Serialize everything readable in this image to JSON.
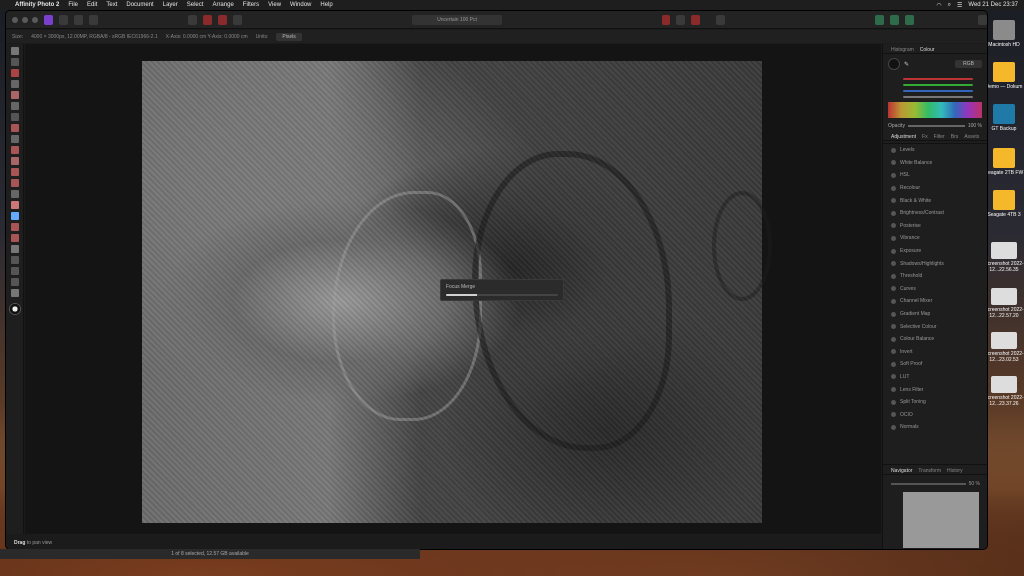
{
  "menubar": {
    "app_name": "Affinity Photo 2",
    "menus": [
      "File",
      "Edit",
      "Text",
      "Document",
      "Layer",
      "Select",
      "Arrange",
      "Filters",
      "View",
      "Window",
      "Help"
    ],
    "clock": "Wed 21 Dec  23:37"
  },
  "window": {
    "center_label": "Uncertain 100 Pct",
    "context_bar": {
      "label": "Size:",
      "items": [
        "4000 × 3000px, 12.00MP, RGBA/8 - sRGB IEC61966-2.1",
        "X-Axis: 0.0000 cm  Y-Axis: 0.0000 cm",
        "Units:"
      ],
      "units_value": "Pixels"
    },
    "status": {
      "label": "Drag",
      "hint": "to pan view"
    }
  },
  "dialog": {
    "title": "Focus Merge",
    "progress": 0.28
  },
  "panels": {
    "top_tabs": [
      "Histogram",
      "Colour"
    ],
    "active_tab": "Colour",
    "colour_mode": "RGB",
    "opacity_label": "Opacity",
    "opacity_value": "100 %",
    "adjust_tabs": [
      "Adjustment",
      "Fx",
      "Filter",
      "Brs",
      "Assets"
    ],
    "adjustments": [
      "Levels",
      "White Balance",
      "HSL",
      "Recolour",
      "Black & White",
      "Brightness/Contrast",
      "Posterise",
      "Vibrance",
      "Exposure",
      "Shadows/Highlights",
      "Threshold",
      "Curves",
      "Channel Mixer",
      "Gradient Map",
      "Selective Colour",
      "Colour Balance",
      "Invert",
      "Soft Proof",
      "LUT",
      "Lens Filter",
      "Split Toning",
      "OCIO",
      "Normals"
    ],
    "nav_tabs": [
      "Navigator",
      "Transform",
      "History"
    ],
    "nav_zoom": "50 %"
  },
  "desktop": {
    "icons": [
      "Macintosh HD",
      "Demo — Dokum",
      "GT Backup",
      "Seagate 2TB FW",
      "Seagate 4TB 3",
      "Screenshot 2022-12...22.56.35",
      "Screenshot 2022-12...22.57.20",
      "Screenshot 2022-12...23.02.53",
      "Screenshot 2022-12...23.37.26"
    ]
  },
  "finder": {
    "status": "1 of 8 selected, 12.57 GB available"
  },
  "colors": {
    "persona": "#7b3fd0",
    "wallpaper_sand": "#8a5a34"
  }
}
